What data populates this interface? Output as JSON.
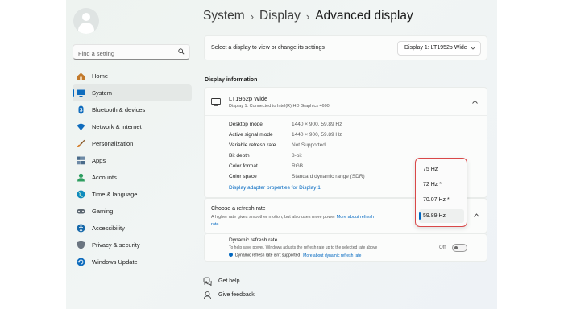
{
  "search": {
    "placeholder": "Find a setting"
  },
  "sidebar": {
    "items": [
      {
        "label": "Home",
        "icon": "home-icon",
        "color": "#c27a2c"
      },
      {
        "label": "System",
        "icon": "monitor-icon",
        "color": "#0f6cbd",
        "active": true
      },
      {
        "label": "Bluetooth & devices",
        "icon": "bluetooth-icon",
        "color": "#0f6cbd"
      },
      {
        "label": "Network & internet",
        "icon": "wifi-icon",
        "color": "#0f6cbd"
      },
      {
        "label": "Personalization",
        "icon": "brush-icon",
        "color": "#d4761c"
      },
      {
        "label": "Apps",
        "icon": "apps-icon",
        "color": "#4a6b8a"
      },
      {
        "label": "Accounts",
        "icon": "accounts-icon",
        "color": "#2e9e60"
      },
      {
        "label": "Time & language",
        "icon": "globe-icon",
        "color": "#0f8bbd"
      },
      {
        "label": "Gaming",
        "icon": "gamepad-icon",
        "color": "#5b6670"
      },
      {
        "label": "Accessibility",
        "icon": "accessibility-icon",
        "color": "#1769aa"
      },
      {
        "label": "Privacy & security",
        "icon": "shield-icon",
        "color": "#6b7580"
      },
      {
        "label": "Windows Update",
        "icon": "update-icon",
        "color": "#0f6cbd"
      }
    ]
  },
  "header": {
    "crumb1": "System",
    "crumb2": "Display",
    "current": "Advanced display",
    "separator": "›"
  },
  "selector": {
    "label": "Select a display to view or change its settings",
    "value": "Display 1: LT1952p Wide"
  },
  "display_info": {
    "section_title": "Display information",
    "device_name": "LT1952p Wide",
    "device_sub": "Display 1: Connected to Intel(R) HD Graphics 4600",
    "rows": [
      {
        "label": "Desktop mode",
        "value": "1440 × 900, 59.89 Hz"
      },
      {
        "label": "Active signal mode",
        "value": "1440 × 900, 59.89 Hz"
      },
      {
        "label": "Variable refresh rate",
        "value": "Not Supported"
      },
      {
        "label": "Bit depth",
        "value": "8-bit"
      },
      {
        "label": "Color format",
        "value": "RGB"
      },
      {
        "label": "Color space",
        "value": "Standard dynamic range (SDR)"
      }
    ],
    "adapter_link": "Display adapter properties for Display 1"
  },
  "refresh": {
    "title": "Choose a refresh rate",
    "subtitle": "A higher rate gives smoother motion, but also uses more power",
    "link_part1": "More about refresh",
    "link_part2": "rate",
    "options": [
      "75 Hz",
      "72 Hz *",
      "70.07 Hz *",
      "59.89 Hz"
    ],
    "selected": "59.89 Hz",
    "highlight_color": "#d94848"
  },
  "dynamic": {
    "title": "Dynamic refresh rate",
    "subtitle": "To help save power, Windows adjusts the refresh rate up to the selected rate above",
    "note": "Dynamic refresh rate isn't supported",
    "note_link": "More about dynamic refresh rate",
    "toggle_label": "Off"
  },
  "footer": {
    "help": "Get help",
    "feedback": "Give feedback"
  },
  "colors": {
    "accent": "#0067c0"
  }
}
